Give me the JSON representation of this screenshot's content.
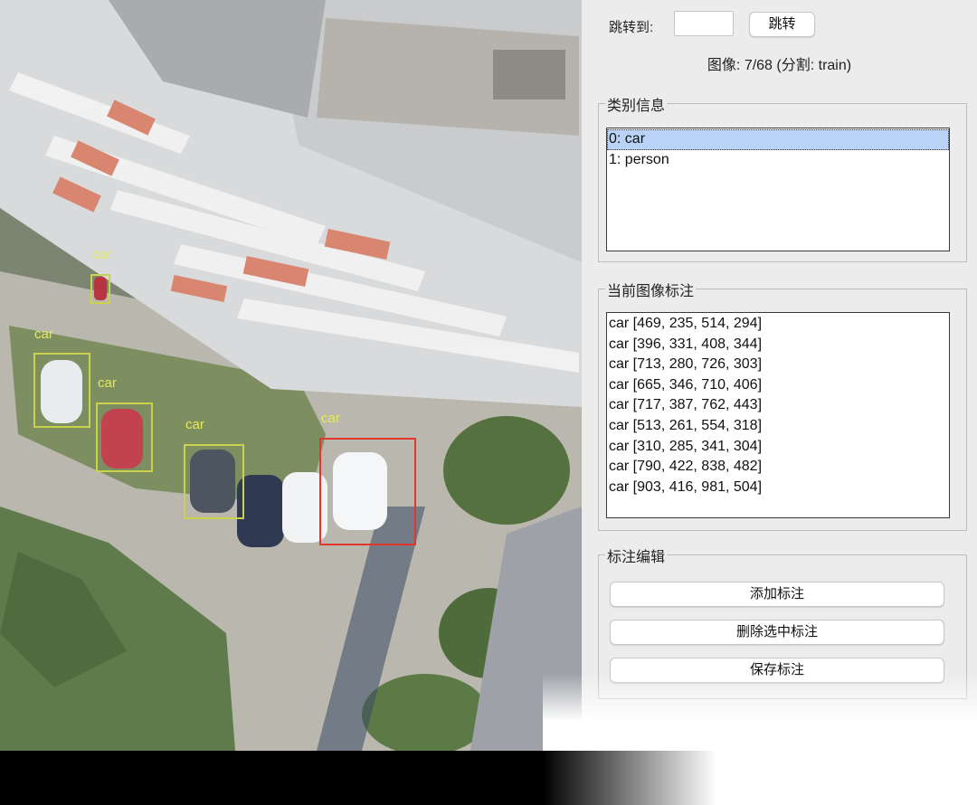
{
  "canvas": {
    "boxes": [
      {
        "label": "car",
        "selected": false
      },
      {
        "label": "car",
        "selected": false
      },
      {
        "label": "car",
        "selected": false
      },
      {
        "label": "car",
        "selected": false
      },
      {
        "label": "car",
        "selected": true
      }
    ]
  },
  "navigation": {
    "jump_label": "跳转到:",
    "jump_input_value": "",
    "jump_button": "跳转",
    "image_info": "图像: 7/68 (分割: train)"
  },
  "class_info": {
    "title": "类别信息",
    "items": [
      "0: car",
      "1: person"
    ],
    "selected_index": 0
  },
  "annotations": {
    "title": "当前图像标注",
    "items": [
      "car [469, 235, 514, 294]",
      "car [396, 331, 408, 344]",
      "car [713, 280, 726, 303]",
      "car [665, 346, 710, 406]",
      "car [717, 387, 762, 443]",
      "car [513, 261, 554, 318]",
      "car [310, 285, 341, 304]",
      "car [790, 422, 838, 482]",
      "car [903, 416, 981, 504]"
    ]
  },
  "edit": {
    "title": "标注编辑",
    "add_button": "添加标注",
    "delete_button": "删除选中标注",
    "save_button": "保存标注"
  },
  "colors": {
    "box": "#c9d24a",
    "selected_box": "#e2352b",
    "label": "#e6ea5a",
    "list_selection": "#b9d3f6"
  }
}
